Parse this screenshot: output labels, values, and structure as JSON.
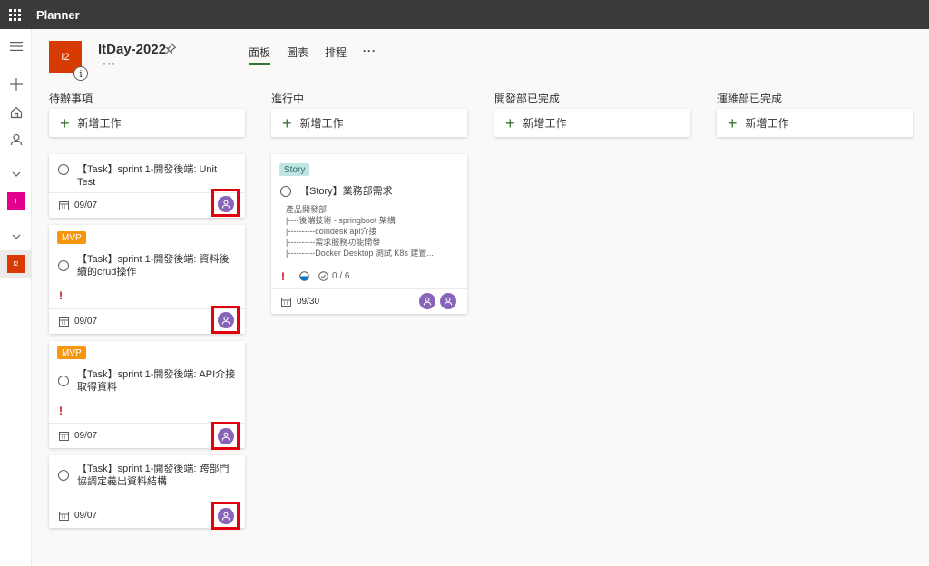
{
  "app": {
    "title": "Planner"
  },
  "rail": {
    "items": [
      {
        "name": "menu",
        "icon": "hamburger-icon"
      },
      {
        "name": "new-plan",
        "icon": "plus-icon"
      },
      {
        "name": "hub",
        "icon": "home-icon"
      },
      {
        "name": "assigned-to-me",
        "icon": "person-icon"
      }
    ],
    "plans": [
      {
        "initials": "I",
        "color": "#e3008c"
      },
      {
        "initials": "I2",
        "color": "#d83b01"
      }
    ]
  },
  "plan": {
    "initials": "I2",
    "name": "ItDay-2022",
    "info": "i",
    "more": "···",
    "color": "#d83b01"
  },
  "tabs": [
    {
      "label": "面板",
      "active": true
    },
    {
      "label": "圖表",
      "active": false
    },
    {
      "label": "排程",
      "active": false
    }
  ],
  "tabs_more": "···",
  "add_task_label": "新增工作",
  "buckets": [
    {
      "title": "待辦事項",
      "tasks": [
        {
          "title": "【Task】sprint 1-開發後端: Unit Test",
          "due": "09/07"
        },
        {
          "label": "MVP",
          "title": "【Task】sprint 1-開發後端: 資料後續的crud操作",
          "priority": "!",
          "due": "09/07"
        },
        {
          "label": "MVP",
          "title": "【Task】sprint 1-開發後端: API介接取得資料",
          "priority": "!",
          "due": "09/07"
        },
        {
          "title": "【Task】sprint 1-開發後端: 跨部門協調定義出資料結構",
          "due": "09/07"
        }
      ]
    },
    {
      "title": "進行中",
      "tasks": [
        {
          "label": "Story",
          "title": "【Story】業務部需求",
          "description": [
            "產品開發部",
            "|----後端技術 - springboot 架構",
            "|----------coindesk api介接",
            "|----------需求服務功能開發",
            "|----------Docker Desktop 測試 K8s 建置..."
          ],
          "priority": "!",
          "checklist": "0 / 6",
          "due": "09/30"
        }
      ]
    },
    {
      "title": "開發部已完成",
      "tasks": []
    },
    {
      "title": "運維部已完成",
      "tasks": []
    }
  ],
  "colors": {
    "topbar": "#3b3a39",
    "accent": "#31752f",
    "avatar": "#8764b8",
    "mvp_label": "#f7960d",
    "story_label": "#bfe5e3",
    "priority": "#c50f1f",
    "highlight": "#e3000f"
  }
}
